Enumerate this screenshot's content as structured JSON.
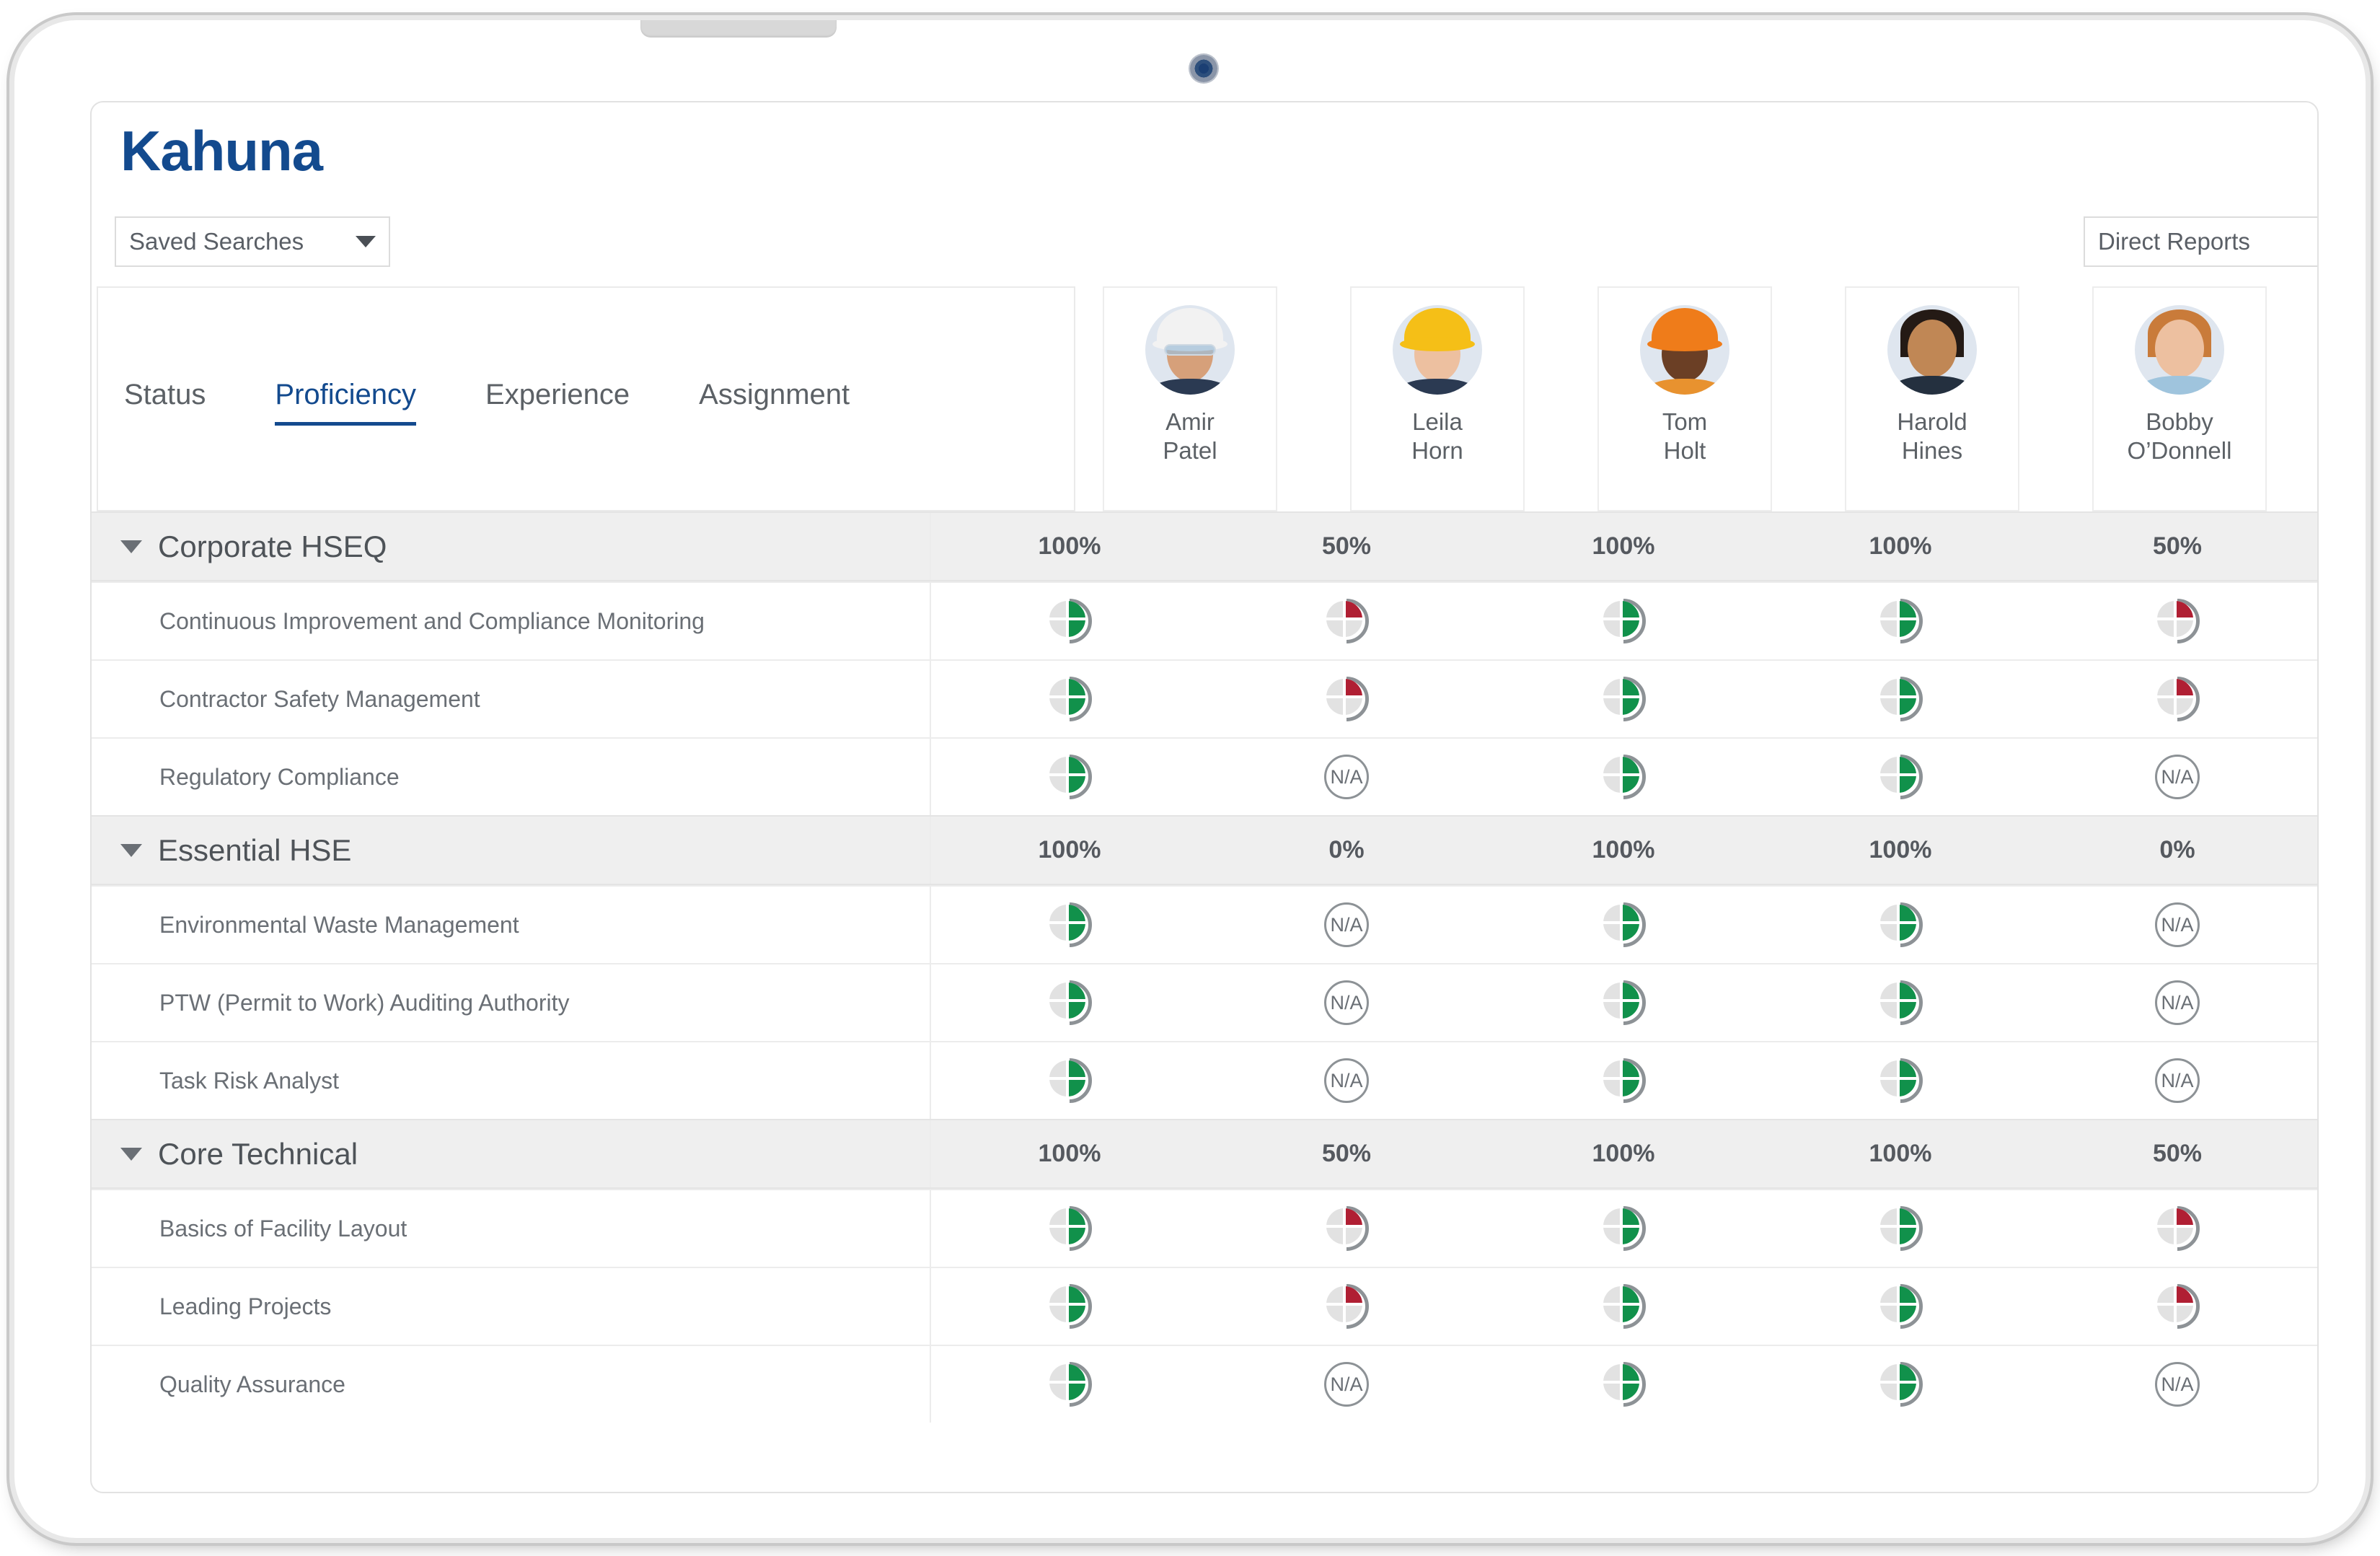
{
  "brand": {
    "name": "Kahuna",
    "color": "#134a8e"
  },
  "toolbar": {
    "saved_searches_label": "Saved Searches",
    "direct_reports_label": "Direct Reports"
  },
  "tabs": [
    {
      "label": "Status",
      "active": false
    },
    {
      "label": "Proficiency",
      "active": true
    },
    {
      "label": "Experience",
      "active": false
    },
    {
      "label": "Assignment",
      "active": false
    }
  ],
  "people": [
    {
      "first": "Amir",
      "last": "Patel",
      "hat": "white"
    },
    {
      "first": "Leila",
      "last": "Horn",
      "hat": "yellow"
    },
    {
      "first": "Tom",
      "last": "Holt",
      "hat": "orange"
    },
    {
      "first": "Harold",
      "last": "Hines",
      "hat": "none"
    },
    {
      "first": "Bobby",
      "last": "O’Donnell",
      "hat": "none"
    }
  ],
  "legend": {
    "state_full": "green-half-pie",
    "state_partial": "red-quarter-pie",
    "state_none": "N/A",
    "na_label": "N/A",
    "green": "#11914b",
    "red": "#b01f33",
    "gray": "#e2e2e2"
  },
  "groups": [
    {
      "name": "Corporate HSEQ",
      "percents": [
        "100%",
        "50%",
        "100%",
        "100%",
        "50%"
      ],
      "items": [
        {
          "name": "Continuous Improvement and Compliance Monitoring",
          "values": [
            "green",
            "red",
            "green",
            "green",
            "red"
          ]
        },
        {
          "name": "Contractor Safety Management",
          "values": [
            "green",
            "red",
            "green",
            "green",
            "red"
          ]
        },
        {
          "name": "Regulatory Compliance",
          "values": [
            "green",
            "na",
            "green",
            "green",
            "na"
          ]
        }
      ]
    },
    {
      "name": "Essential HSE",
      "percents": [
        "100%",
        "0%",
        "100%",
        "100%",
        "0%"
      ],
      "items": [
        {
          "name": "Environmental Waste Management",
          "values": [
            "green",
            "na",
            "green",
            "green",
            "na"
          ]
        },
        {
          "name": "PTW (Permit to Work) Auditing Authority",
          "values": [
            "green",
            "na",
            "green",
            "green",
            "na"
          ]
        },
        {
          "name": "Task Risk Analyst",
          "values": [
            "green",
            "na",
            "green",
            "green",
            "na"
          ]
        }
      ]
    },
    {
      "name": "Core Technical",
      "percents": [
        "100%",
        "50%",
        "100%",
        "100%",
        "50%"
      ],
      "items": [
        {
          "name": "Basics of Facility Layout",
          "values": [
            "green",
            "red",
            "green",
            "green",
            "red"
          ]
        },
        {
          "name": "Leading Projects",
          "values": [
            "green",
            "red",
            "green",
            "green",
            "red"
          ]
        },
        {
          "name": "Quality Assurance",
          "values": [
            "green",
            "na",
            "green",
            "green",
            "na"
          ]
        }
      ]
    }
  ]
}
